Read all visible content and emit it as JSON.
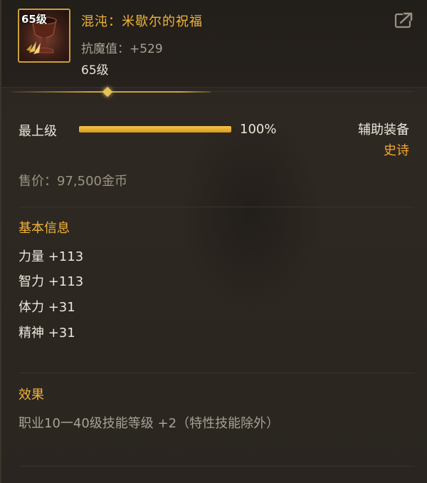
{
  "item": {
    "icon_level": "65级",
    "name": "混沌：米歇尔的祝福",
    "resist": "抗魔值：+529",
    "level": "65级"
  },
  "grade": {
    "label": "最上级",
    "percent_value": 100,
    "percent_text": "100%"
  },
  "slot_type": "辅助装备",
  "rarity": "史诗",
  "price": "售价：97,500金币",
  "basic_info": {
    "title": "基本信息",
    "stats": [
      "力量 +113",
      "智力 +113",
      "体力 +31",
      "精神 +31"
    ]
  },
  "effect": {
    "title": "效果",
    "text": "职业10一40级技能等级 +2（特性技能除外）"
  },
  "colors": {
    "accent_gold": "#f0b33a",
    "rarity_orange": "#f0a830",
    "icon_border": "#c8a13a"
  },
  "icons": {
    "item": "goblet-icon",
    "share": "share-icon"
  }
}
